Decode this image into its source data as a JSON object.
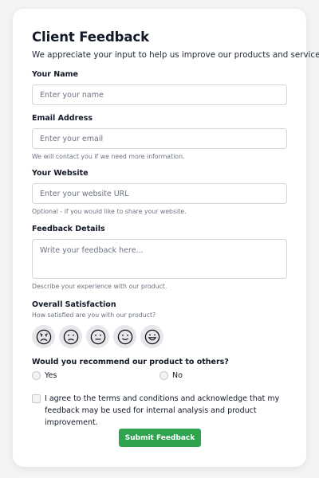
{
  "form": {
    "title": "Client Feedback",
    "subtitle": "We appreciate your input to help us improve our products and services.",
    "name": {
      "label": "Your Name",
      "placeholder": "Enter your name"
    },
    "email": {
      "label": "Email Address",
      "placeholder": "Enter your email",
      "help": "We will contact you if we need more information."
    },
    "website": {
      "label": "Your Website",
      "placeholder": "Enter your website URL",
      "help": "Optional - if you would like to share your website."
    },
    "feedback": {
      "label": "Feedback Details",
      "placeholder": "Write your feedback here...",
      "help": "Describe your experience with our product."
    },
    "satisfaction": {
      "label": "Overall Satisfaction",
      "help": "How satisfied are you with our product?",
      "options": [
        "very-dissatisfied-icon",
        "dissatisfied-icon",
        "neutral-icon",
        "satisfied-icon",
        "very-satisfied-icon"
      ]
    },
    "recommend": {
      "label": "Would you recommend our product to others?",
      "yes": "Yes",
      "no": "No"
    },
    "agreement": "I agree to the terms and conditions and acknowledge that my feedback may be used for internal analysis and product improvement.",
    "submit": "Submit Feedback"
  },
  "colors": {
    "accent": "#2ea44f",
    "input_border": "#d1d5db",
    "face_bg": "#e5e7eb"
  }
}
